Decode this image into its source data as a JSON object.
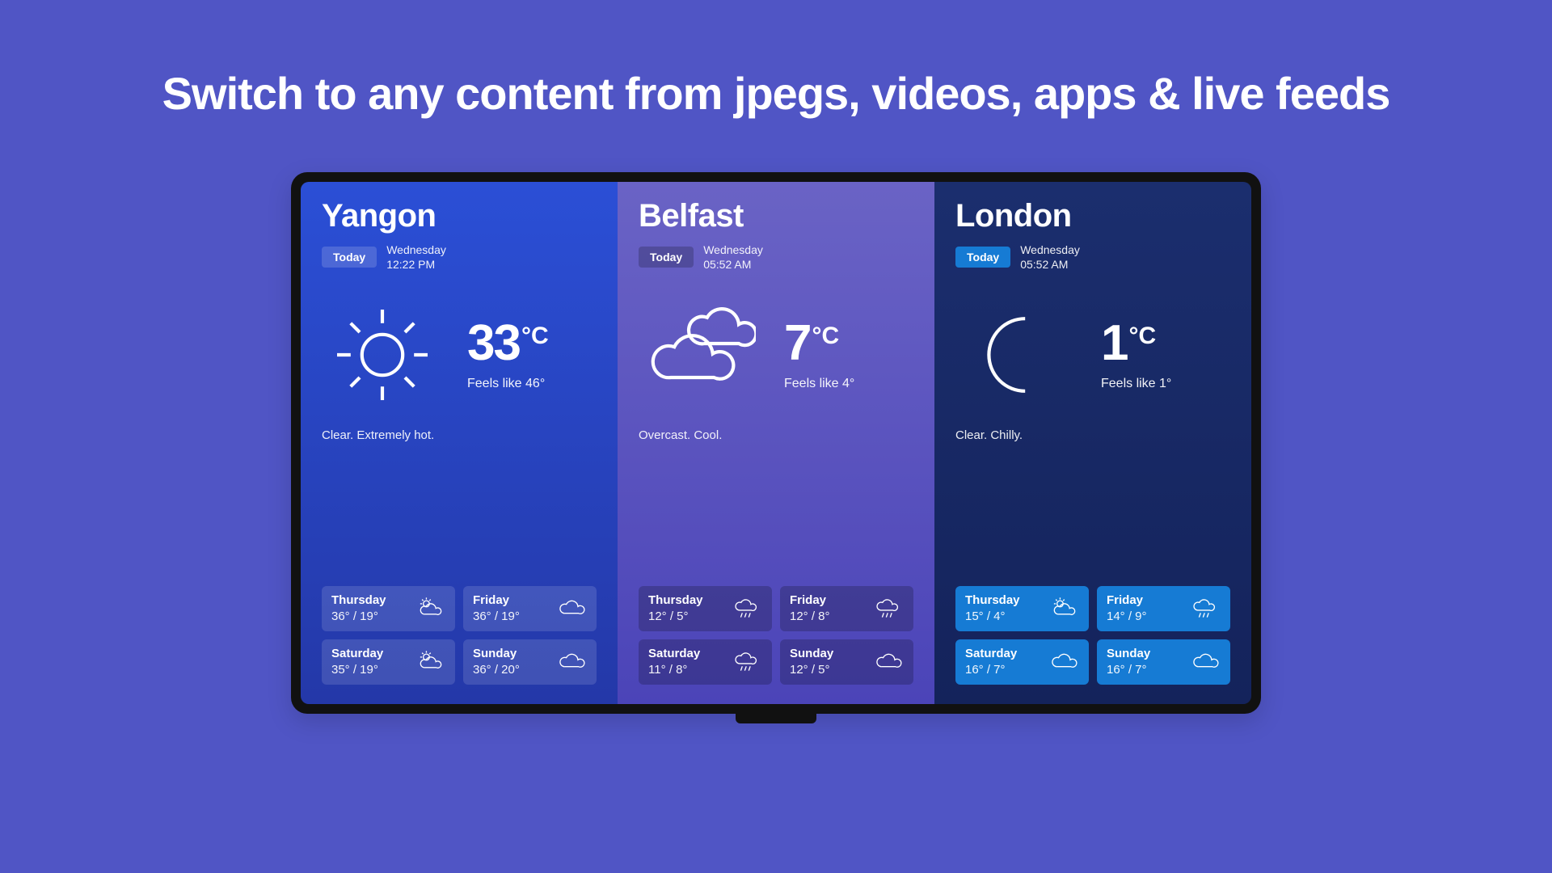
{
  "headline": "Switch to any content from jpegs, videos, apps & live feeds",
  "panels": [
    {
      "city": "Yangon",
      "today_label": "Today",
      "day_name": "Wednesday",
      "time": "12:22 PM",
      "temp": "33",
      "unit": "°C",
      "feels_like": "Feels like 46°",
      "condition": "Clear. Extremely hot.",
      "icon": "sun",
      "forecast": [
        {
          "day": "Thursday",
          "temps": "36° / 19°",
          "icon": "partly-cloudy"
        },
        {
          "day": "Friday",
          "temps": "36° / 19°",
          "icon": "cloud"
        },
        {
          "day": "Saturday",
          "temps": "35° / 19°",
          "icon": "partly-cloudy"
        },
        {
          "day": "Sunday",
          "temps": "36° / 20°",
          "icon": "cloud"
        }
      ]
    },
    {
      "city": "Belfast",
      "today_label": "Today",
      "day_name": "Wednesday",
      "time": "05:52 AM",
      "temp": "7",
      "unit": "°C",
      "feels_like": "Feels like 4°",
      "condition": "Overcast. Cool.",
      "icon": "clouds",
      "forecast": [
        {
          "day": "Thursday",
          "temps": "12° / 5°",
          "icon": "rain"
        },
        {
          "day": "Friday",
          "temps": "12° / 8°",
          "icon": "rain"
        },
        {
          "day": "Saturday",
          "temps": "11° / 8°",
          "icon": "rain"
        },
        {
          "day": "Sunday",
          "temps": "12° / 5°",
          "icon": "cloud"
        }
      ]
    },
    {
      "city": "London",
      "today_label": "Today",
      "day_name": "Wednesday",
      "time": "05:52 AM",
      "temp": "1",
      "unit": "°C",
      "feels_like": "Feels like 1°",
      "condition": "Clear. Chilly.",
      "icon": "moon",
      "forecast": [
        {
          "day": "Thursday",
          "temps": "15° / 4°",
          "icon": "partly-cloudy"
        },
        {
          "day": "Friday",
          "temps": "14° / 9°",
          "icon": "rain"
        },
        {
          "day": "Saturday",
          "temps": "16° / 7°",
          "icon": "cloud"
        },
        {
          "day": "Sunday",
          "temps": "16° / 7°",
          "icon": "cloud"
        }
      ]
    }
  ]
}
